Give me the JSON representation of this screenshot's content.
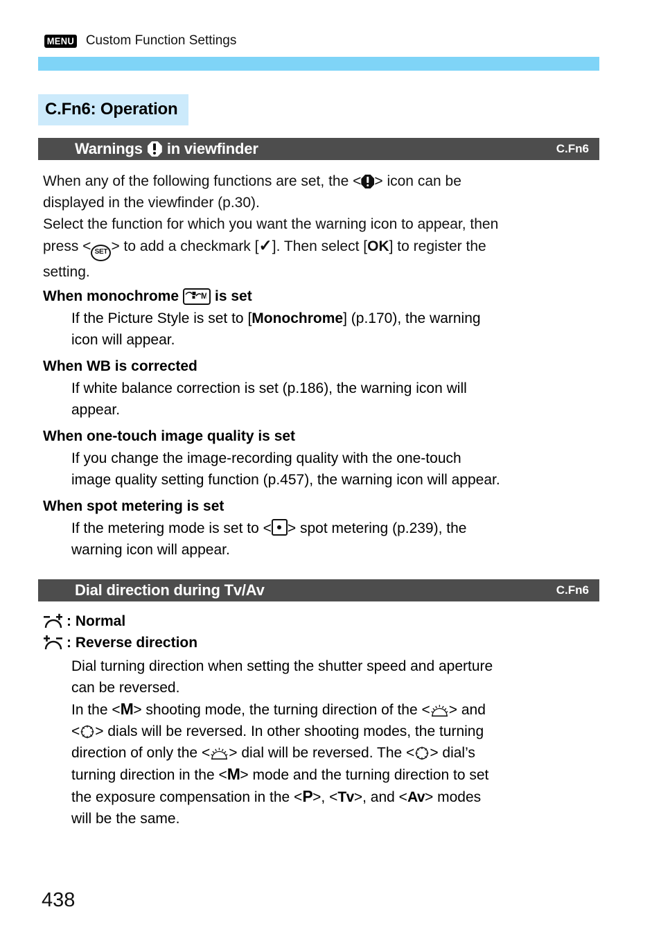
{
  "running_head": {
    "menu_badge": "MENU",
    "title": "Custom Function Settings"
  },
  "group_title": "C.Fn6: Operation",
  "sections": [
    {
      "bar": {
        "name_prefix": "Warnings",
        "name_suffix": "in viewfinder",
        "icon": "warning-octagon-icon",
        "code": "C.Fn6"
      },
      "intro": {
        "line1_a": "When any of the following functions are set, the <",
        "line1_b": "> icon can be",
        "line2": "displayed in the viewfinder (p.30).",
        "line3": "Select the function for which you want the warning icon to appear, then",
        "line4_a": "press <",
        "line4_b": "> to add a checkmark [",
        "line4_check": "✓",
        "line4_c": "]. Then select [",
        "line4_ok": "OK",
        "line4_d": "] to register the",
        "line5": "setting."
      },
      "items": [
        {
          "heading_a": "When monochrome",
          "heading_icon": "monochrome-picture-style-icon",
          "heading_b": "is set",
          "body_a": "If the Picture Style is set to [",
          "body_bold": "Monochrome",
          "body_b": "] (p.170), the warning",
          "body_line2": "icon will appear."
        },
        {
          "heading": "When WB is corrected",
          "body_line1": "If white balance correction is set (p.186), the warning icon will",
          "body_line2": "appear."
        },
        {
          "heading": "When one-touch image quality is set",
          "body_line1": "If you change the image-recording quality with the one-touch",
          "body_line2": "image quality setting function (p.457), the warning icon will appear."
        },
        {
          "heading": "When spot metering is set",
          "body_a": "If the metering mode is set to <",
          "body_icon": "spot-metering-icon",
          "body_b": "> spot metering (p.239), the",
          "body_line2": "warning icon will appear."
        }
      ]
    },
    {
      "bar": {
        "name": "Dial direction during Tv/Av",
        "code": "C.Fn6"
      },
      "options": [
        {
          "icon": "dial-normal-icon",
          "label": ": Normal"
        },
        {
          "icon": "dial-reverse-icon",
          "label": ": Reverse direction"
        }
      ],
      "body": {
        "line1": "Dial turning direction when setting the shutter speed and aperture",
        "line2": "can be reversed.",
        "line3_a": "In the <",
        "line3_mode": "M",
        "line3_b": "> shooting mode, the turning direction of the <",
        "line3_icon": "main-dial-icon",
        "line3_c": "> and",
        "line4_icon": "quick-control-dial-icon",
        "line4_a": "<",
        "line4_b": "> dials will be reversed. In other shooting modes, the turning",
        "line5_a": "direction of only the <",
        "line5_icon": "main-dial-icon",
        "line5_b": "> dial will be reversed. The <",
        "line5_icon2": "quick-control-dial-icon",
        "line5_c": "> dial’s",
        "line6_a": "turning direction in the <",
        "line6_mode": "M",
        "line6_b": "> mode and the turning direction to set",
        "line7_a": "the exposure compensation in the <",
        "line7_mode1": "P",
        "line7_b": ">, <",
        "line7_mode2": "Tv",
        "line7_c": ">, and <",
        "line7_mode3": "Av",
        "line7_d": "> modes",
        "line8": "will be the same."
      }
    }
  ],
  "page_number": "438",
  "colors": {
    "top_bar_blue": "#7fd4f7",
    "group_title_blue": "#cceafb",
    "function_bar_gray": "#4d4d4d"
  }
}
